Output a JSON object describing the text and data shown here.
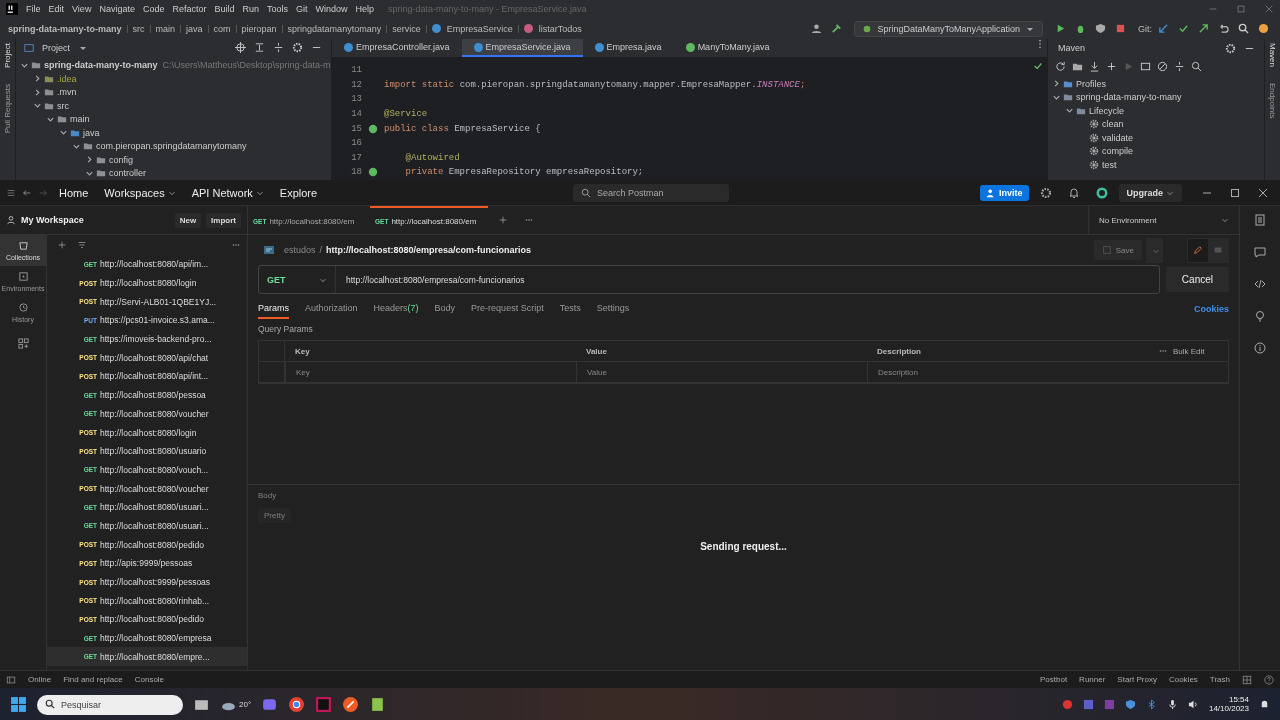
{
  "ide": {
    "menu": [
      "File",
      "Edit",
      "View",
      "Navigate",
      "Code",
      "Refactor",
      "Build",
      "Run",
      "Tools",
      "Git",
      "Window",
      "Help"
    ],
    "title": "spring-data-many-to-many - EmpresaService.java",
    "breadcrumb": [
      "spring-data-many-to-many",
      "src",
      "main",
      "java",
      "com",
      "pieropan",
      "springdatamanytomany",
      "service",
      "EmpresaService",
      "listarTodos"
    ],
    "run_config": "SpringDataManyToManyApplication",
    "git_label": "Git:",
    "stripe_left": [
      "Project",
      "Pull Requests"
    ],
    "project_label": "Project",
    "tree": [
      {
        "label": "spring-data-many-to-many",
        "path": "C:\\Users\\Mattheus\\Desktop\\spring-data-m",
        "expanded": true,
        "kind": "module",
        "children": [
          {
            "label": ".idea",
            "expanded": false,
            "kind": "folder-ignored"
          },
          {
            "label": ".mvn",
            "expanded": false,
            "kind": "folder"
          },
          {
            "label": "src",
            "expanded": true,
            "kind": "folder",
            "children": [
              {
                "label": "main",
                "expanded": true,
                "kind": "folder",
                "children": [
                  {
                    "label": "java",
                    "expanded": true,
                    "kind": "source",
                    "children": [
                      {
                        "label": "com.pieropan.springdatamanytomany",
                        "expanded": true,
                        "kind": "package",
                        "children": [
                          {
                            "label": "config",
                            "expanded": false,
                            "kind": "package"
                          },
                          {
                            "label": "controller",
                            "expanded": true,
                            "kind": "package"
                          }
                        ]
                      }
                    ]
                  }
                ]
              }
            ]
          }
        ]
      }
    ],
    "editor_tabs": [
      {
        "label": "EmpresaController.java",
        "selected": false,
        "kind": "class"
      },
      {
        "label": "EmpresaService.java",
        "selected": true,
        "kind": "class"
      },
      {
        "label": "Empresa.java",
        "selected": false,
        "kind": "class"
      },
      {
        "label": "ManyToMany.java",
        "selected": false,
        "kind": "app"
      }
    ],
    "code": [
      {
        "number": "11",
        "bean": false
      },
      {
        "number": "12",
        "bean": false,
        "tokens": [
          {
            "text": "import static ",
            "kind": "keyword"
          },
          {
            "text": "com.pieropan.springdatamanytomany.mapper.EmpresaMapper.",
            "kind": "plain"
          },
          {
            "text": "INSTANCE",
            "kind": "constant"
          },
          {
            "text": ";",
            "kind": "keyword"
          }
        ]
      },
      {
        "number": "13",
        "bean": false
      },
      {
        "number": "14",
        "bean": false,
        "tokens": [
          {
            "text": "@Service",
            "kind": "annotation"
          }
        ]
      },
      {
        "number": "15",
        "bean": true,
        "tokens": [
          {
            "text": "public class ",
            "kind": "keyword"
          },
          {
            "text": "EmpresaService {",
            "kind": "plain"
          }
        ]
      },
      {
        "number": "16",
        "bean": false
      },
      {
        "number": "17",
        "bean": false,
        "tokens": [
          {
            "text": "    @Autowired",
            "kind": "annotation"
          }
        ]
      },
      {
        "number": "18",
        "bean": true,
        "tokens": [
          {
            "text": "    private ",
            "kind": "keyword"
          },
          {
            "text": "EmpresaRepository empresaRepository;",
            "kind": "plain"
          }
        ]
      }
    ],
    "maven_label": "Maven",
    "maven_tree": [
      {
        "label": "Profiles",
        "expanded": false,
        "kind": "profiles"
      },
      {
        "label": "spring-data-many-to-many",
        "expanded": true,
        "kind": "project",
        "children": [
          {
            "label": "Lifecycle",
            "expanded": true,
            "kind": "lifecycle",
            "children": [
              {
                "label": "clean",
                "kind": "goal"
              },
              {
                "label": "validate",
                "kind": "goal"
              },
              {
                "label": "compile",
                "kind": "goal"
              },
              {
                "label": "test",
                "kind": "goal"
              }
            ]
          }
        ]
      }
    ],
    "stripe_right": [
      "Maven",
      "Endpoints"
    ]
  },
  "postman": {
    "nav": [
      {
        "label": "Home",
        "dropdown": false
      },
      {
        "label": "Workspaces",
        "dropdown": true
      },
      {
        "label": "API Network",
        "dropdown": true
      },
      {
        "label": "Explore",
        "dropdown": false
      }
    ],
    "search_placeholder": "Search Postman",
    "invite": "Invite",
    "upgrade": "Upgrade",
    "workspace": "My Workspace",
    "new_button": "New",
    "import_button": "Import",
    "request_tabs": [
      {
        "method": "GET",
        "label": "http://localhost:8080/em",
        "selected": false
      },
      {
        "method": "GET",
        "label": "http://localhost:8080/em",
        "selected": true
      }
    ],
    "environment": "No Environment",
    "side_nav": [
      {
        "label": "Collections",
        "selected": true,
        "kind": "collections"
      },
      {
        "label": "Environments",
        "selected": false,
        "kind": "environments"
      },
      {
        "label": "History",
        "selected": false,
        "kind": "history"
      }
    ],
    "requests": [
      {
        "method": "GET",
        "url": "http://localhost:8080/api/im...",
        "selected": false
      },
      {
        "method": "POST",
        "url": "http://localhost:8080/login",
        "selected": false
      },
      {
        "method": "POST",
        "url": "http://Servi-ALB01-1QBE1YJ...",
        "selected": false
      },
      {
        "method": "PUT",
        "url": "https://pcs01-invoice.s3.ama...",
        "selected": false
      },
      {
        "method": "GET",
        "url": "https://imoveis-backend-pro...",
        "selected": false
      },
      {
        "method": "POST",
        "url": "http://localhost:8080/api/chat",
        "selected": false
      },
      {
        "method": "POST",
        "url": "http://localhost:8080/api/int...",
        "selected": false
      },
      {
        "method": "GET",
        "url": "http://localhost:8080/pessoa",
        "selected": false
      },
      {
        "method": "GET",
        "url": "http://localhost:8080/voucher",
        "selected": false
      },
      {
        "method": "POST",
        "url": "http://localhost:8080/login",
        "selected": false
      },
      {
        "method": "POST",
        "url": "http://localhost:8080/usuario",
        "selected": false
      },
      {
        "method": "GET",
        "url": "http://localhost:8080/vouch...",
        "selected": false
      },
      {
        "method": "POST",
        "url": "http://localhost:8080/voucher",
        "selected": false
      },
      {
        "method": "GET",
        "url": "http://localhost:8080/usuari...",
        "selected": false
      },
      {
        "method": "GET",
        "url": "http://localhost:8080/usuari...",
        "selected": false
      },
      {
        "method": "POST",
        "url": "http://localhost:8080/pedido",
        "selected": false
      },
      {
        "method": "POST",
        "url": "http://apis:9999/pessoas",
        "selected": false
      },
      {
        "method": "POST",
        "url": "http://localhost:9999/pessoas",
        "selected": false
      },
      {
        "method": "POST",
        "url": "http://localhost:8080/rinhab...",
        "selected": false
      },
      {
        "method": "POST",
        "url": "http://localhost:8080/pedido",
        "selected": false
      },
      {
        "method": "GET",
        "url": "http://localhost:8080/empresa",
        "selected": false
      },
      {
        "method": "GET",
        "url": "http://localhost:8080/empre...",
        "selected": true
      }
    ],
    "collection": "estudos",
    "path_separator": "/",
    "request_name": "http://localhost:8080/empresa/com-funcionarios",
    "save": "Save",
    "method": "GET",
    "url": "http://localhost:8080/empresa/com-funcionarios",
    "cancel": "Cancel",
    "tabs": [
      {
        "label": "Params",
        "selected": true
      },
      {
        "label": "Authorization",
        "selected": false
      },
      {
        "label": "Headers",
        "count": "(7)",
        "selected": false
      },
      {
        "label": "Body",
        "selected": false
      },
      {
        "label": "Pre-request Script",
        "selected": false
      },
      {
        "label": "Tests",
        "selected": false
      },
      {
        "label": "Settings",
        "selected": false
      }
    ],
    "cookies": "Cookies",
    "query_params": "Query Params",
    "columns": [
      "Key",
      "Value",
      "Description"
    ],
    "bulk_edit": "Bulk Edit",
    "placeholders": [
      "Key",
      "Value",
      "Description"
    ],
    "response": {
      "tab": "Body",
      "format": "Pretty",
      "status": "Sending request..."
    },
    "status_left": [
      "Online",
      "Find and replace",
      "Console"
    ],
    "status_right": [
      "Postbot",
      "Runner",
      "Start Proxy",
      "Cookies",
      "Trash"
    ]
  },
  "taskbar": {
    "search_placeholder": "Pesquisar",
    "weather": "20°",
    "time": "15:54",
    "date": "14/10/2023"
  }
}
